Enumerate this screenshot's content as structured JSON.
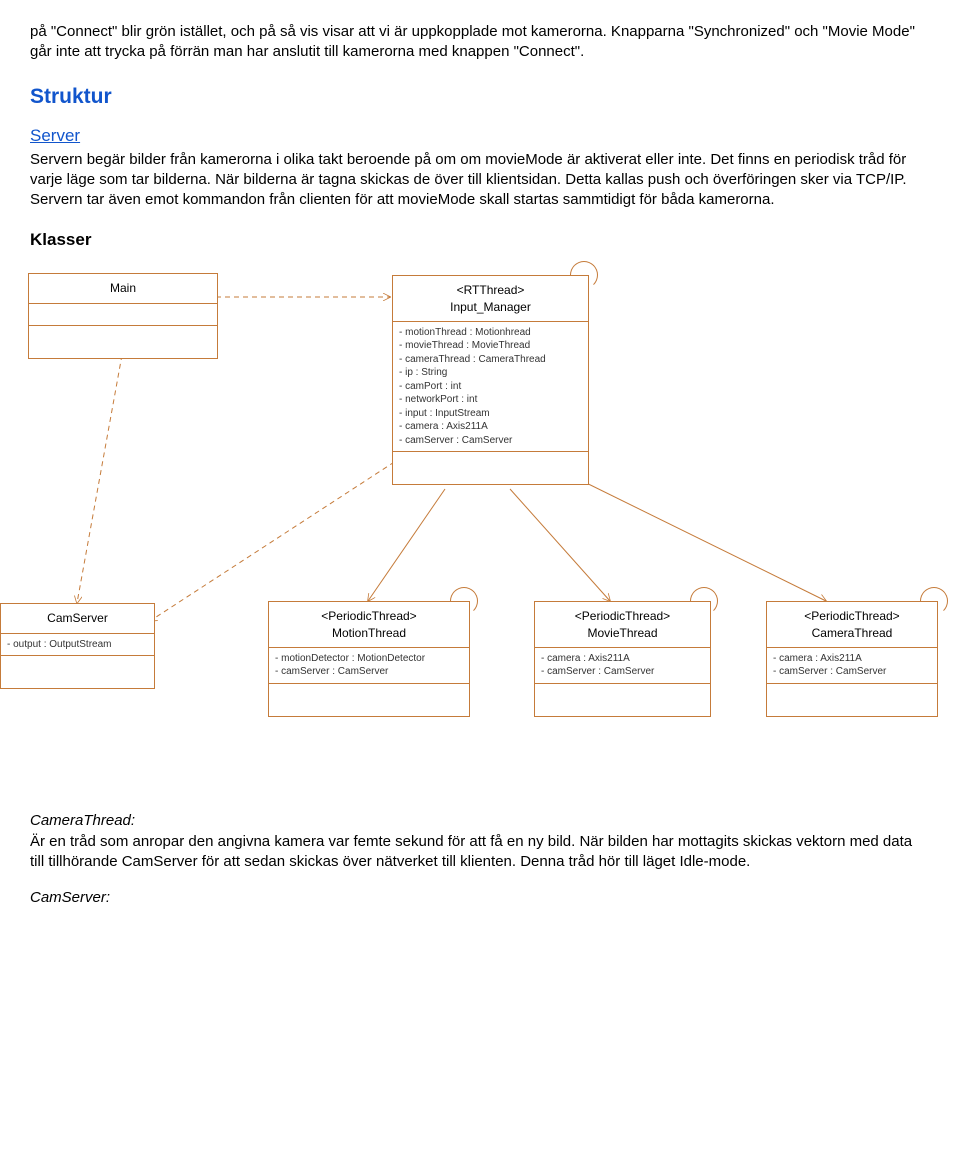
{
  "intro": {
    "p1": "på \"Connect\" blir grön istället, och på så vis visar att vi är uppkopplade mot kamerorna. Knapparna \"Synchronized\" och \"Movie Mode\" går inte att trycka på förrän man har anslutit till kamerorna med knappen \"Connect\"."
  },
  "struktur": {
    "heading": "Struktur",
    "server_link": "Server",
    "server_desc": "Servern begär bilder från kamerorna i olika takt beroende på om om movieMode är aktiverat eller inte. Det finns en periodisk tråd för varje läge som tar bilderna. När bilderna är tagna skickas de över till klientsidan. Detta kallas push och överföringen sker via TCP/IP. Servern tar även emot kommandon från clienten för att movieMode skall startas sammtidigt för båda kamerorna.",
    "klasser_heading": "Klasser"
  },
  "uml": {
    "main": {
      "title": "Main"
    },
    "input_manager": {
      "stereotype": "<RTThread>",
      "title": "Input_Manager",
      "attrs": [
        "- motionThread : Motionhread",
        "- movieThread : MovieThread",
        "- cameraThread : CameraThread",
        "- ip : String",
        "- camPort : int",
        "- networkPort : int",
        "- input : InputStream",
        "- camera : Axis211A",
        "- camServer : CamServer"
      ]
    },
    "cam_server": {
      "title": "CamServer",
      "attrs": [
        "- output : OutputStream"
      ]
    },
    "motion_thread": {
      "stereotype": "<PeriodicThread>",
      "title": "MotionThread",
      "attrs": [
        "- motionDetector : MotionDetector",
        "- camServer : CamServer"
      ]
    },
    "movie_thread": {
      "stereotype": "<PeriodicThread>",
      "title": "MovieThread",
      "attrs": [
        "- camera : Axis211A",
        "- camServer : CamServer"
      ]
    },
    "camera_thread": {
      "stereotype": "<PeriodicThread>",
      "title": "CameraThread",
      "attrs": [
        "- camera : Axis211A",
        "- camServer : CamServer"
      ]
    }
  },
  "footer": {
    "camera_thread_heading": "CameraThread:",
    "camera_thread_desc": "Är en tråd som anropar den angivna kamera var femte sekund för att få en ny bild. När bilden har mottagits skickas vektorn med data till tillhörande CamServer för att sedan skickas över nätverket till klienten. Denna tråd hör till läget Idle-mode.",
    "cam_server_heading": "CamServer:"
  }
}
